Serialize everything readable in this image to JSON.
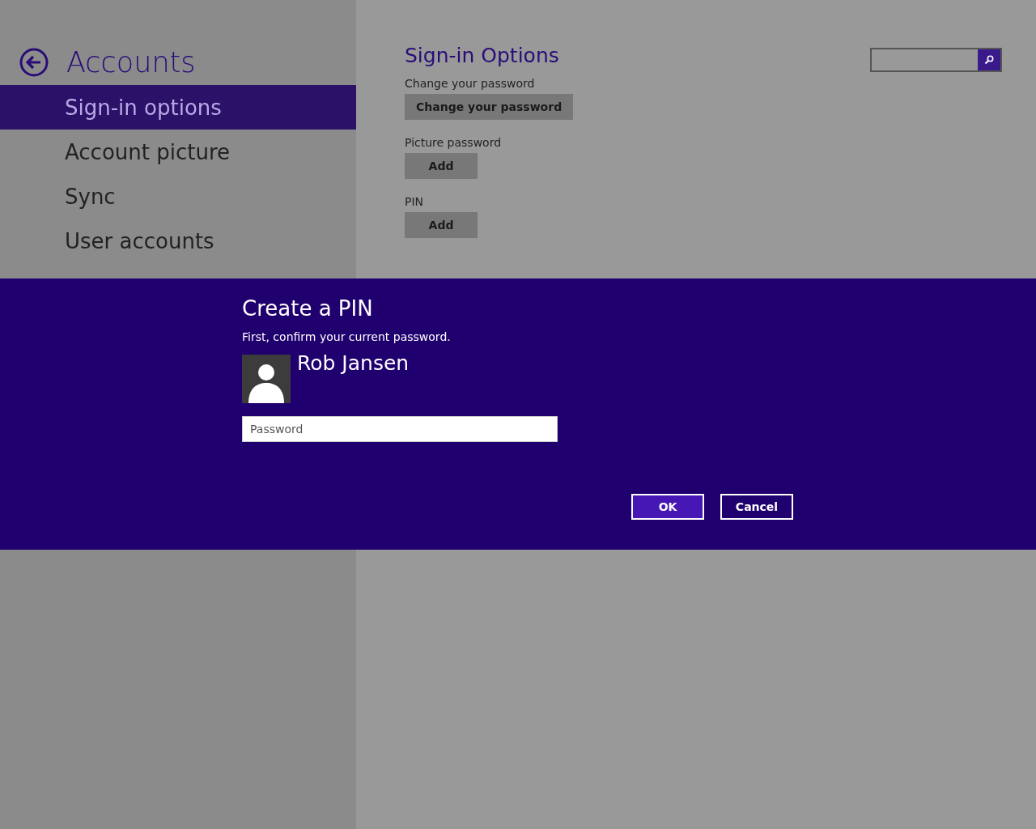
{
  "sidebar": {
    "title": "Accounts",
    "items": [
      {
        "label": "Sign-in options",
        "selected": true
      },
      {
        "label": "Account picture",
        "selected": false
      },
      {
        "label": "Sync",
        "selected": false
      },
      {
        "label": "User accounts",
        "selected": false
      }
    ]
  },
  "content": {
    "title": "Sign-in Options",
    "sections": [
      {
        "label": "Change your password",
        "button": "Change your password"
      },
      {
        "label": "Picture password",
        "button": "Add"
      },
      {
        "label": "PIN",
        "button": "Add"
      }
    ]
  },
  "dialog": {
    "title": "Create a PIN",
    "message": "First, confirm your current password.",
    "user_name": "Rob Jansen",
    "password": {
      "placeholder": "Password"
    },
    "buttons": [
      {
        "label": "OK",
        "kind": "primary"
      },
      {
        "label": "Cancel",
        "kind": "secondary"
      }
    ]
  }
}
